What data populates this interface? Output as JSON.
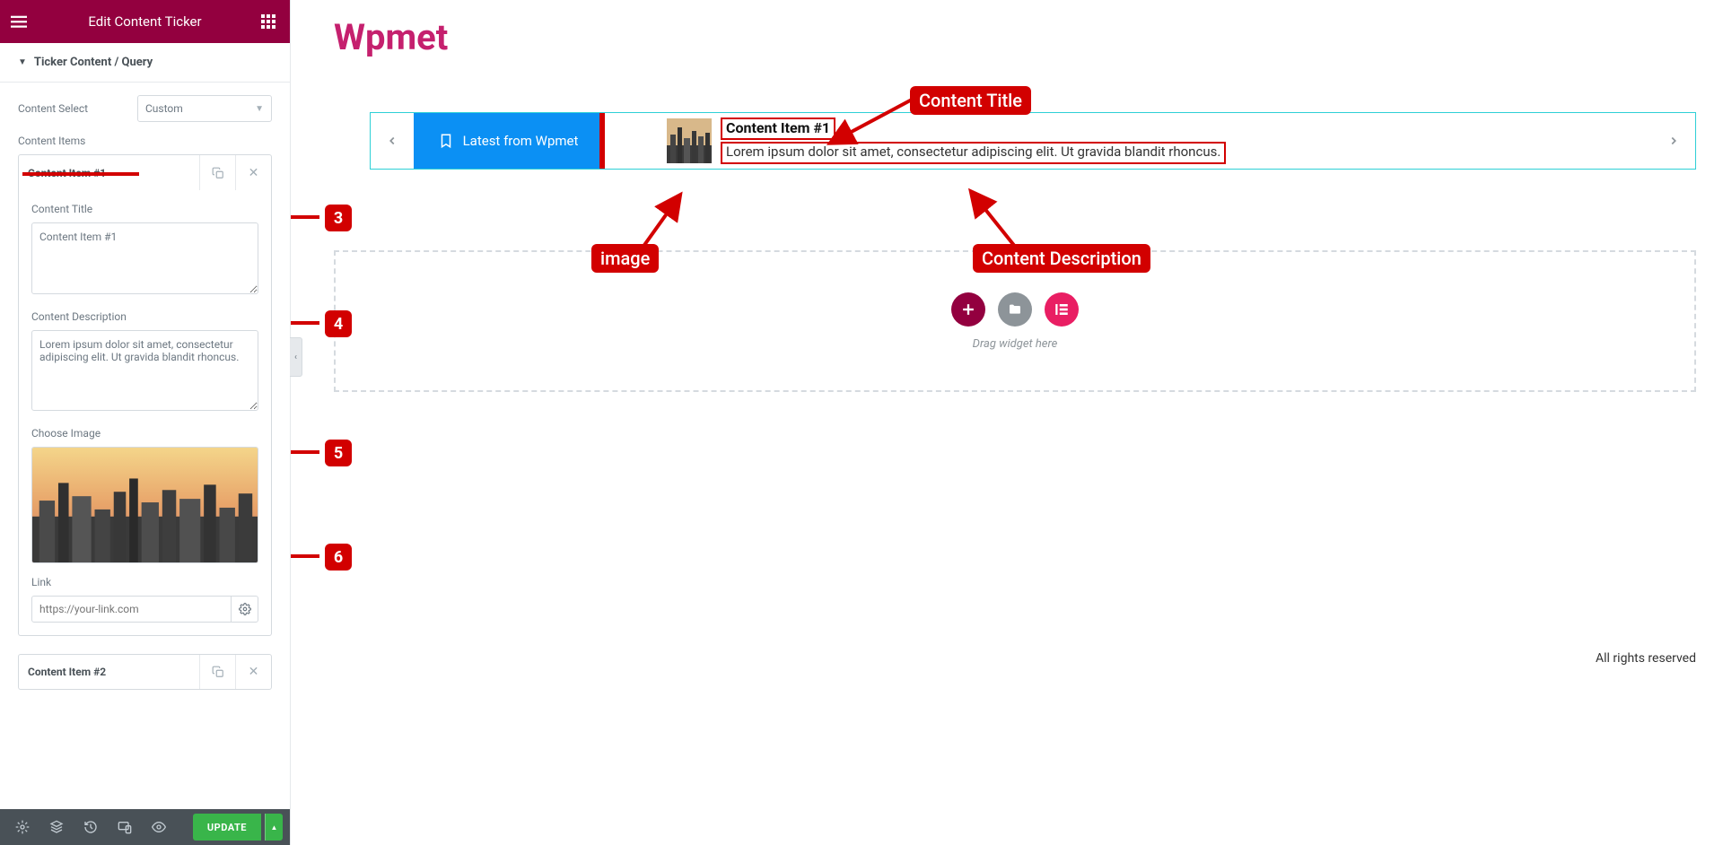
{
  "panel": {
    "header_title": "Edit Content Ticker",
    "section_title": "Ticker Content / Query",
    "labels": {
      "content_select": "Content Select",
      "content_items": "Content Items",
      "content_title": "Content Title",
      "content_description": "Content Description",
      "choose_image": "Choose Image",
      "link": "Link"
    },
    "content_select_value": "Custom",
    "items": [
      {
        "header": "Content Item #1"
      },
      {
        "header": "Content Item #2"
      }
    ],
    "fields": {
      "title_value": "Content Item #1",
      "description_value": "Lorem ipsum dolor sit amet, consectetur adipiscing elit. Ut gravida blandit rhoncus.",
      "link_placeholder": "https://your-link.com"
    },
    "footer": {
      "update": "UPDATE"
    }
  },
  "preview": {
    "page_title": "Wpmet",
    "ticker_label": "Latest from Wpmet",
    "ticker_title": "Content Item #1",
    "ticker_description": "Lorem ipsum dolor sit amet, consectetur adipiscing elit. Ut gravida blandit rhoncus.",
    "dropzone_text": "Drag widget here",
    "footer_text": "All rights reserved"
  },
  "annotations": {
    "content_title": "Content Title",
    "image": "image",
    "content_description": "Content Description",
    "n3": "3",
    "n4": "4",
    "n5": "5",
    "n6": "6"
  }
}
